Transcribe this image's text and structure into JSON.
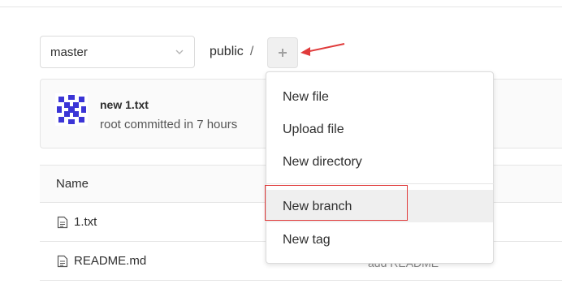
{
  "repo_nav": {
    "branch": "master",
    "breadcrumb": {
      "path": "public",
      "separator": "/"
    }
  },
  "last_commit": {
    "title": "new 1.txt",
    "meta": "root committed in 7 hours"
  },
  "file_table": {
    "columns": [
      "Name"
    ],
    "rows": [
      {
        "name": "1.txt"
      },
      {
        "name": "README.md",
        "commit_message": "add README"
      }
    ]
  },
  "add_menu": {
    "items": [
      "New file",
      "Upload file",
      "New directory",
      "New branch",
      "New tag"
    ]
  },
  "colors": {
    "annotation_red": "#e03b3b",
    "avatar_blue": "#3b35d6"
  }
}
